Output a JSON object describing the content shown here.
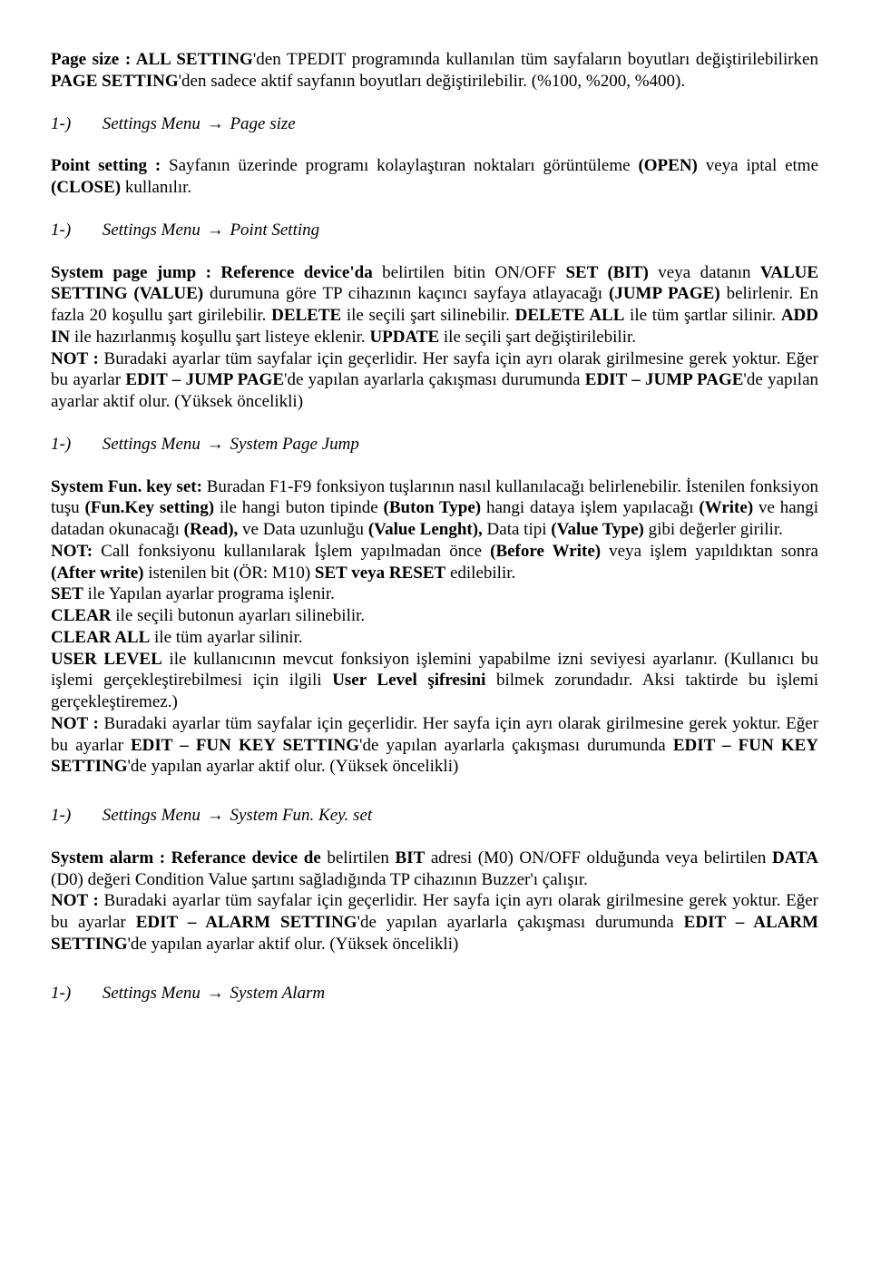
{
  "p1": {
    "lead": "Page size : ALL SETTING",
    "r1": "'den TPEDIT programında kullanılan tüm sayfaların boyutları değiştirilebilirken ",
    "b2": "PAGE SETTING",
    "r2": "'den sadece aktif sayfanın boyutları değiştirilebilir. (%100, %200, %400)."
  },
  "nav1": {
    "num": "1-)",
    "menu": "Settings Menu ",
    "dest": " Page size"
  },
  "p2": {
    "lead": "Point setting :",
    "r1": " Sayfanın üzerinde programı kolaylaştıran noktaları görüntüleme ",
    "b2": "(OPEN)",
    "r2": " veya iptal etme ",
    "b3": "(CLOSE)",
    "r3": " kullanılır."
  },
  "nav2": {
    "num": "1-)",
    "menu": "Settings Menu ",
    "dest": " Point Setting"
  },
  "p3": {
    "b1": "System page jump : Reference device'da",
    "r1": " belirtilen bitin ON/OFF ",
    "b2": "SET (BIT)",
    "r2": " veya datanın ",
    "b3": "VALUE SETTING (VALUE)",
    "r3": " durumuna göre TP cihazının kaçıncı sayfaya atlayacağı ",
    "b4": "(JUMP PAGE)",
    "r4": " belirlenir. En fazla 20 koşullu şart girilebilir. ",
    "b5": "DELETE",
    "r5": " ile seçili şart silinebilir. ",
    "b6": "DELETE ALL",
    "r6": " ile tüm şartlar silinir. ",
    "b7": "ADD IN",
    "r7": " ile hazırlanmış koşullu şart listeye eklenir. ",
    "b8": "UPDATE",
    "r8": " ile seçili şart değiştirilebilir.",
    "br1a": "NOT :",
    "br1b": " Buradaki ayarlar tüm sayfalar için geçerlidir. Her sayfa için ayrı olarak girilmesine gerek yoktur. Eğer bu ayarlar ",
    "b9": "EDIT – JUMP PAGE",
    "r9": "'de yapılan ayarlarla çakışması durumunda ",
    "b10": "EDIT – JUMP PAGE",
    "r10": "'de yapılan ayarlar aktif olur. (Yüksek öncelikli)"
  },
  "nav3": {
    "num": "1-)",
    "menu": "Settings Menu ",
    "dest": " System Page Jump"
  },
  "p4": {
    "b1": "System Fun. key set:",
    "r1": " Buradan F1-F9 fonksiyon tuşlarının nasıl kullanılacağı belirlenebilir. İstenilen fonksiyon tuşu ",
    "b2": "(Fun.Key setting)",
    "r2": " ile hangi buton tipinde ",
    "b3": "(Buton Type)",
    "r3": " hangi dataya işlem yapılacağı ",
    "b4": "(Write)",
    "r4": " ve hangi datadan okunacağı ",
    "b5": "(Read),",
    "r5": " ve Data uzunluğu ",
    "b6": "(Value Lenght),",
    "r6": " Data tipi ",
    "b7": "(Value Type)",
    "r7": "  gibi değerler girilir.",
    "br_not": "NOT:",
    "br_notb": " Call fonksiyonu kullanılarak İşlem yapılmadan önce ",
    "b8": "(Before Write)",
    "r8": " veya işlem yapıldıktan sonra ",
    "b9": "(After write)",
    "r9": " istenilen bit (ÖR: M10) ",
    "b10": "SET veya RESET",
    "r10": " edilebilir.",
    "l_set": "SET",
    "l_set_r": " ile Yapılan ayarlar programa işlenir.",
    "l_clear": "CLEAR",
    "l_clear_r": " ile seçili butonun ayarları silinebilir.",
    "l_clearall": "CLEAR ALL",
    "l_clearall_r": " ile tüm ayarlar silinir.",
    "l_ul": "USER LEVEL",
    "l_ul_r": " ile kullanıcının mevcut fonksiyon işlemini yapabilme izni seviyesi ayarlanır. (Kullanıcı bu işlemi gerçekleştirebilmesi için ilgili ",
    "l_ul_b": "User Level şifresini",
    "l_ul_r2": " bilmek zorundadır. Aksi taktirde bu işlemi gerçekleştiremez.)",
    "l_not2": "NOT :",
    "l_not2_r": " Buradaki ayarlar tüm sayfalar için geçerlidir. Her sayfa için ayrı olarak girilmesine gerek yoktur. Eğer bu ayarlar ",
    "b11": "EDIT – FUN KEY SETTING",
    "r11": "'de yapılan ayarlarla çakışması durumunda ",
    "b12": "EDIT – FUN KEY SETTING",
    "r12": "'de yapılan ayarlar aktif olur. (Yüksek öncelikli)"
  },
  "nav4": {
    "num": "1-)",
    "menu": "Settings Menu ",
    "dest": " System Fun. Key. set"
  },
  "p5": {
    "b1": "System alarm : Referance device de",
    "r1": " belirtilen ",
    "b2": "BIT",
    "r2": " adresi (M0) ON/OFF olduğunda veya belirtilen ",
    "b3": "DATA",
    "r3": " (D0) değeri Condition Value şartını sağladığında TP cihazının Buzzer'ı çalışır.",
    "l_not": "NOT :",
    "l_not_r": " Buradaki ayarlar tüm sayfalar için geçerlidir. Her sayfa için ayrı olarak girilmesine gerek yoktur. Eğer bu ayarlar ",
    "b4": "EDIT – ALARM SETTING",
    "r4": "'de yapılan ayarlarla çakışması durumunda ",
    "b5": "EDIT – ALARM SETTING",
    "r5": "'de yapılan ayarlar aktif olur. (Yüksek öncelikli)"
  },
  "nav5": {
    "num": "1-)",
    "menu": "Settings Menu ",
    "dest": " System Alarm"
  },
  "arrow": "→"
}
